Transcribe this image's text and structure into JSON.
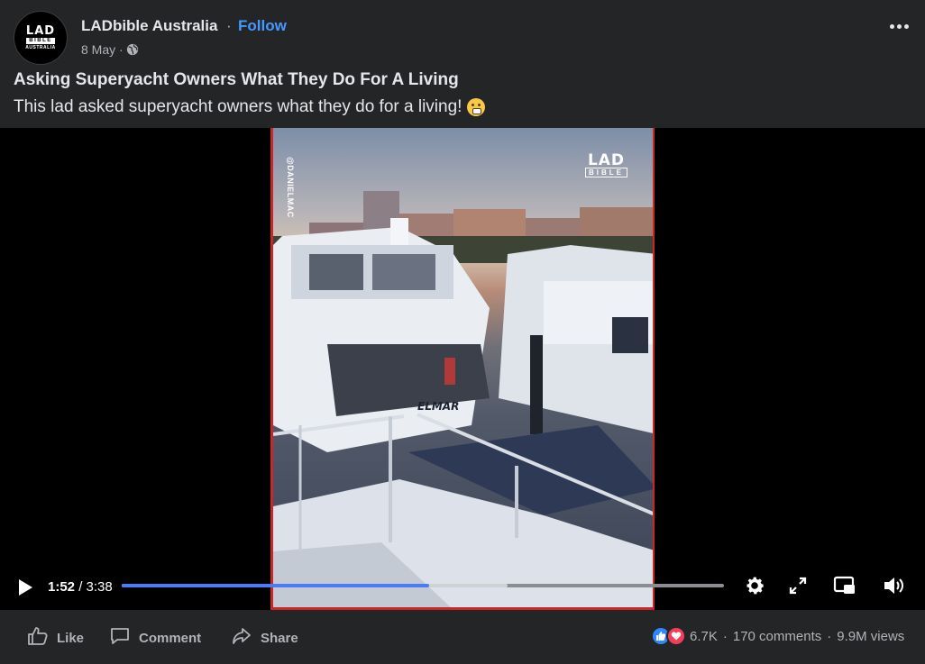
{
  "header": {
    "page_name": "LADbible Australia",
    "separator": "·",
    "follow_label": "Follow",
    "date": "8 May ·",
    "avatar": {
      "line1": "LAD",
      "line2": "BIBLE",
      "line3": "AUSTRALIA"
    }
  },
  "post": {
    "title": "Asking Superyacht Owners What They Do For A Living",
    "body": "This lad asked superyacht owners what they do for a living!",
    "emoji": "grimacing-face-icon"
  },
  "video": {
    "watermark_top": "LAD",
    "watermark_bottom": "BIBLE",
    "handle": "@DANIELMAC",
    "hull_name": "ELMAR",
    "current_time": "1:52",
    "total_time": " / 3:38",
    "played_fraction": 0.51,
    "buffered_fraction": 0.64,
    "accent": "#4a7bf5",
    "border": "#c8282a"
  },
  "footer": {
    "like_label": "Like",
    "comment_label": "Comment",
    "share_label": "Share",
    "reaction_count": "6.7K",
    "dot": "·",
    "comments_count": "170 comments",
    "views_count": "9.9M views"
  }
}
